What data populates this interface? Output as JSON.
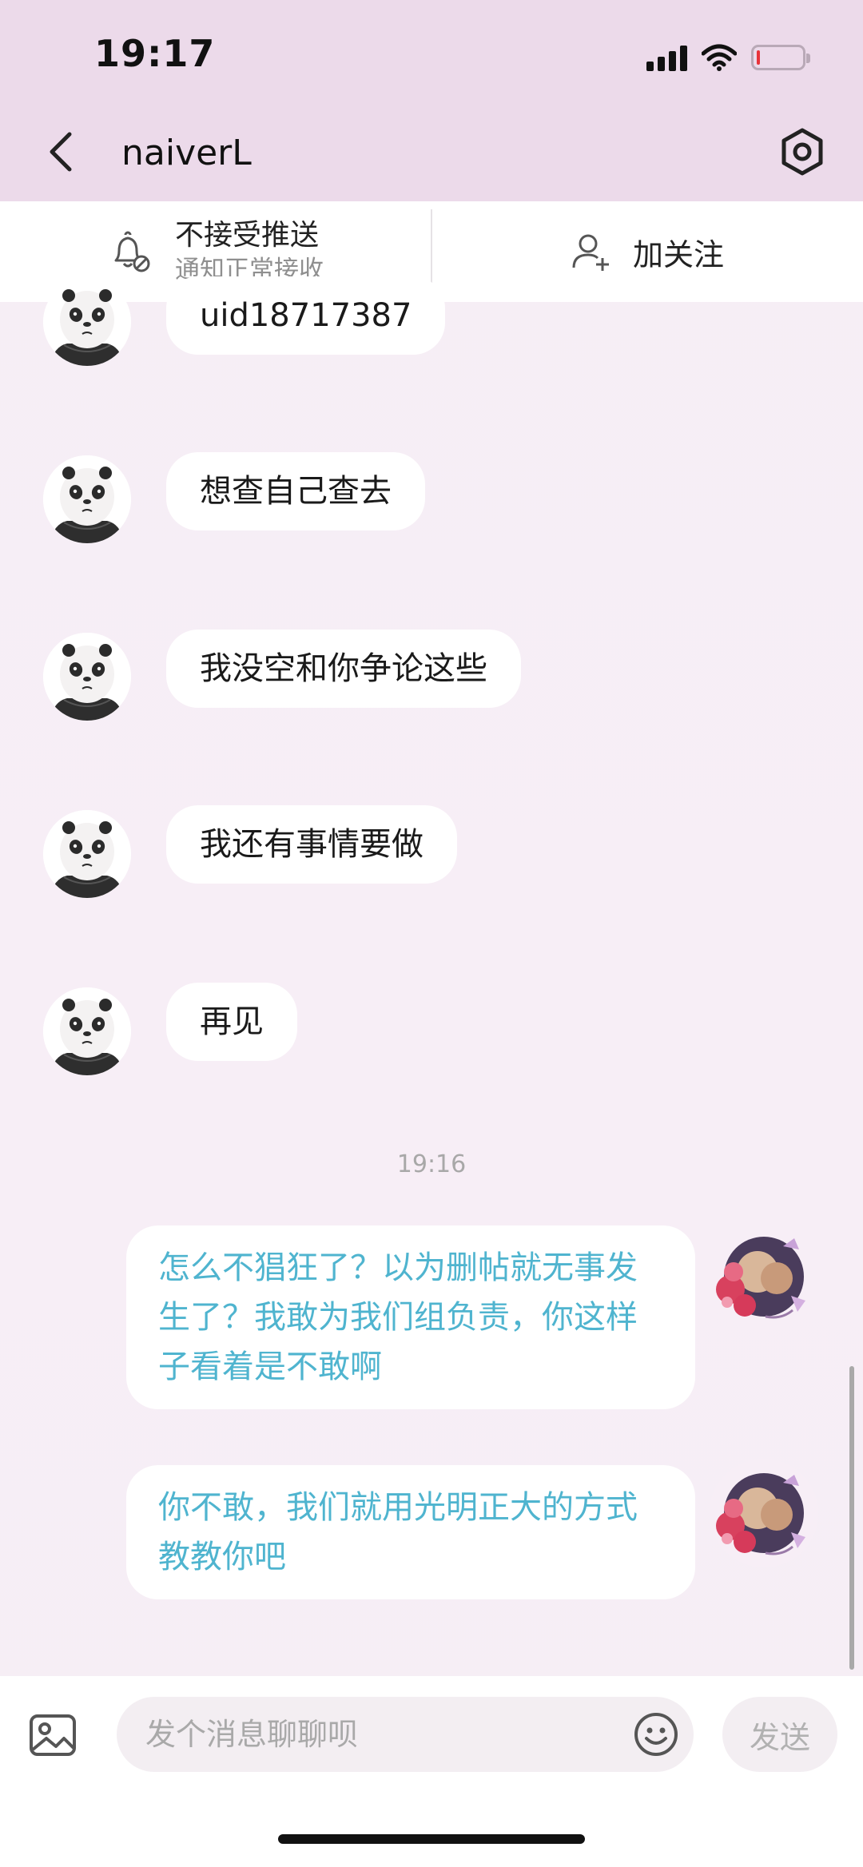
{
  "status_bar": {
    "time": "19:17",
    "battery_level": 0.08
  },
  "header": {
    "title": "naiverL"
  },
  "actions": {
    "mute_label": "不接受推送",
    "mute_sub": "通知正常接收",
    "follow_label": "加关注"
  },
  "messages": {
    "incoming": [
      {
        "text": "uid18717387"
      },
      {
        "text": "想查自己查去"
      },
      {
        "text": "我没空和你争论这些"
      },
      {
        "text": "我还有事情要做"
      },
      {
        "text": "再见"
      }
    ],
    "timestamp": "19:16",
    "outgoing": [
      {
        "text": "怎么不猖狂了？以为删帖就无事发生了？我敢为我们组负责，你这样子看着是不敢啊"
      },
      {
        "text": "你不敢，我们就用光明正大的方式教教你吧"
      }
    ]
  },
  "input": {
    "placeholder": "发个消息聊聊呗",
    "send_label": "发送"
  },
  "colors": {
    "header_bg": "#ecdaea",
    "outgoing_text": "#4fb4cf",
    "battery_low": "#e8333a"
  }
}
